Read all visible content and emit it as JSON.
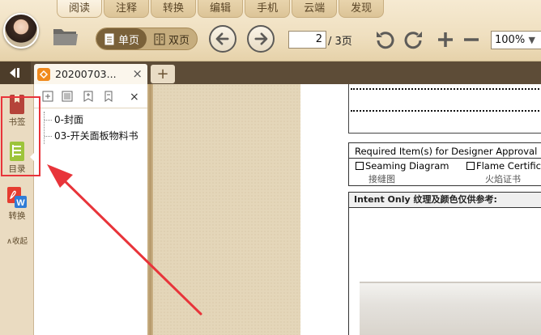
{
  "menu": {
    "tabs": [
      "阅读",
      "注释",
      "转换",
      "编辑",
      "手机",
      "云端",
      "发现"
    ],
    "active_index": 0
  },
  "toolbar": {
    "single_page_label": "单页",
    "double_page_label": "双页",
    "page_current": "2",
    "page_total": "/ 3页",
    "zoom": "100%"
  },
  "tabbar": {
    "doc_tab_label": "20200703...",
    "doc_tab_close": "×",
    "new_tab": "+"
  },
  "side": {
    "bookmark_label": "书签",
    "toc_label": "目录",
    "convert_label": "转换",
    "collapse_label": "∧收起"
  },
  "toc": {
    "close": "×",
    "items": [
      "0-封面",
      "03-开关面板物料书"
    ]
  },
  "document": {
    "required_title": "Required Item(s) for Designer Approval Prio",
    "seaming_label": "Seaming Diagram",
    "seaming_cn": "接缝图",
    "flame_label": "Flame Certifica",
    "flame_cn": "火焰证书",
    "intent_header": "Intent Only  纹理及颜色仅供参考:"
  },
  "colors": {
    "annotation": "#e8343a",
    "tab_bar": "#5d4c37",
    "ribbon": "#efdfbf"
  }
}
